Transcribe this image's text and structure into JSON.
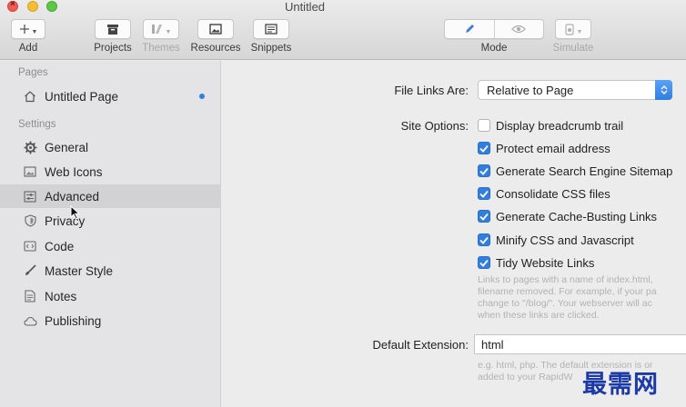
{
  "window": {
    "title": "Untitled"
  },
  "toolbar": {
    "add_label": "Add",
    "projects_label": "Projects",
    "themes_label": "Themes",
    "resources_label": "Resources",
    "snippets_label": "Snippets",
    "mode_label": "Mode",
    "simulate_label": "Simulate"
  },
  "sidebar": {
    "pages_header": "Pages",
    "pages": [
      {
        "label": "Untitled Page"
      }
    ],
    "settings_header": "Settings",
    "settings": [
      {
        "label": "General"
      },
      {
        "label": "Web Icons"
      },
      {
        "label": "Advanced"
      },
      {
        "label": "Privacy"
      },
      {
        "label": "Code"
      },
      {
        "label": "Master Style"
      },
      {
        "label": "Notes"
      },
      {
        "label": "Publishing"
      }
    ]
  },
  "main": {
    "file_links_label": "File Links Are:",
    "file_links_value": "Relative to Page",
    "site_options_label": "Site Options:",
    "options": [
      {
        "label": "Display breadcrumb trail",
        "checked": false
      },
      {
        "label": "Protect email address",
        "checked": true
      },
      {
        "label": "Generate Search Engine Sitemap",
        "checked": true
      },
      {
        "label": "Consolidate CSS files",
        "checked": true
      },
      {
        "label": "Generate Cache-Busting Links",
        "checked": true
      },
      {
        "label": "Minify CSS and Javascript",
        "checked": true
      },
      {
        "label": "Tidy Website Links",
        "checked": true
      }
    ],
    "tidy_help": [
      "Links to pages with a name of index.html,",
      "filename removed. For example, if your pa",
      "change to \"/blog/\". Your webserver will ac",
      "when these links are clicked."
    ],
    "default_extension_label": "Default Extension:",
    "default_extension_value": "html",
    "extension_help": [
      "e.g. html, php. The default extension is or",
      "added to your RapidW"
    ]
  },
  "watermark": "最需网",
  "colors": {
    "accent": "#2f7ee0",
    "watermark": "#1b3aa8"
  }
}
